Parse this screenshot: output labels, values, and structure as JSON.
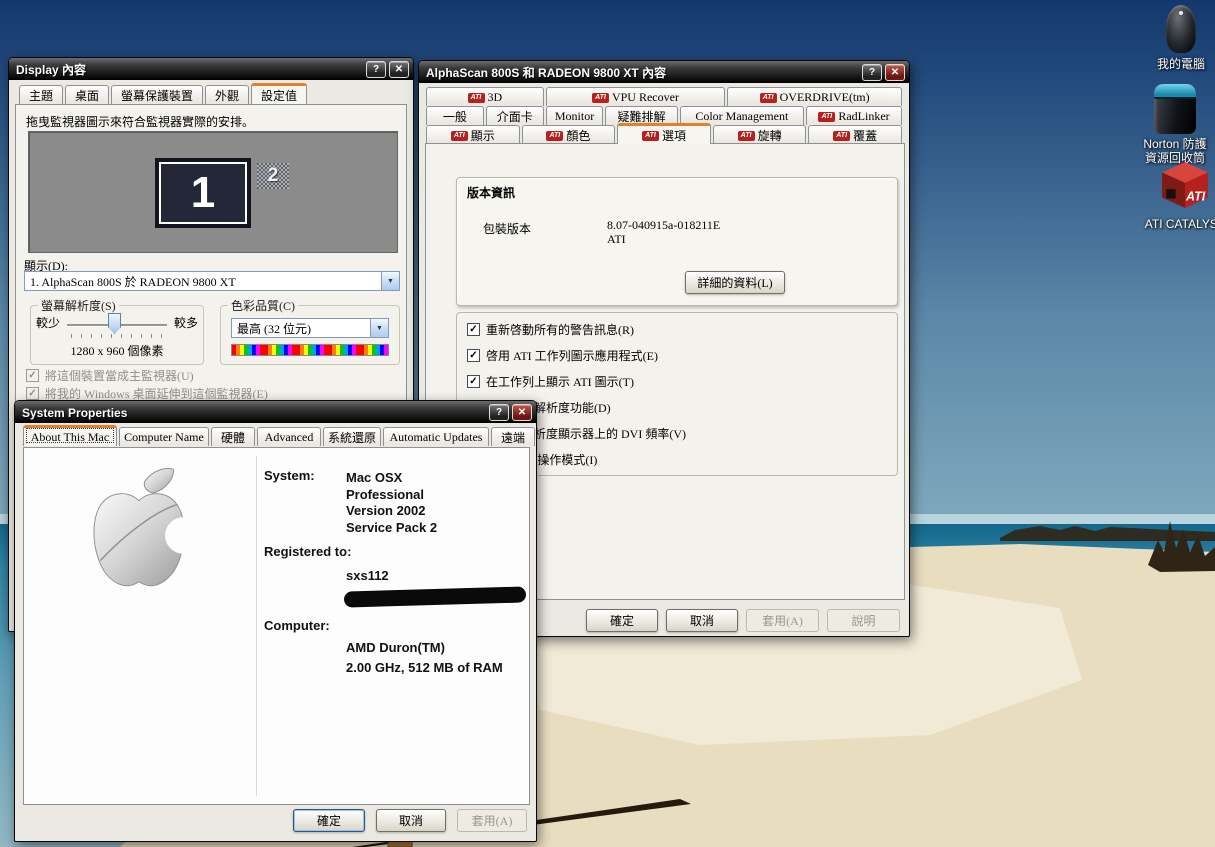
{
  "chrome": {
    "help": "?",
    "close": "✕",
    "check": "✓",
    "chevron": "▼"
  },
  "icons": {
    "ati_chip_text": "ATI"
  },
  "colors": {
    "accent_tab_orange": "#e0812f",
    "titlebar_dark": "#1a1a1a",
    "ati_red": "#b5211d",
    "sky_top": "#16386d",
    "sea": "#2f84a4",
    "sand": "#e8ddbf"
  },
  "desktop": {
    "icons": [
      {
        "name": "my-computer",
        "label": "我的電腦"
      },
      {
        "name": "norton-recycle-bin",
        "label_line1": "Norton 防護",
        "label_line2": "資源回收筒"
      },
      {
        "name": "ati-catalyst",
        "label": "ATI CATALYST"
      }
    ]
  },
  "display_dialog": {
    "title": "Display 內容",
    "tabs": [
      "主題",
      "桌面",
      "螢幕保護裝置",
      "外觀",
      "設定值"
    ],
    "active_tab": "設定值",
    "instruction": "拖曳監視器圖示來符合監視器實際的安排。",
    "monitor1": "1",
    "monitor2": "2",
    "display_label": "顯示(D):",
    "display_value": "1. AlphaScan 800S 於 RADEON 9800 XT",
    "resolution_group": {
      "title": "螢幕解析度(S)",
      "less": "較少",
      "more": "較多",
      "value": "1280 x 960 個像素"
    },
    "color_group": {
      "title": "色彩品質(C)",
      "value": "最高 (32 位元)"
    },
    "checkbox_primary": "將這個裝置當成主監視器(U)",
    "checkbox_extend": "將我的 Windows 桌面延伸到這個監視器(E)"
  },
  "ati_dialog": {
    "title": "AlphaScan 800S 和 RADEON 9800 XT 內容",
    "tab_rows": [
      [
        {
          "label": "3D"
        },
        {
          "label": "VPU Recover"
        },
        {
          "label": "OVERDRIVE(tm)"
        }
      ],
      [
        {
          "label": "一般"
        },
        {
          "label": "介面卡"
        },
        {
          "label": "Monitor"
        },
        {
          "label": "疑難排解"
        },
        {
          "label": "Color Management"
        },
        {
          "label": "RadLinker"
        }
      ],
      [
        {
          "label": "顯示"
        },
        {
          "label": "顏色"
        },
        {
          "label": "選項"
        },
        {
          "label": "旋轉"
        },
        {
          "label": "覆蓋"
        }
      ]
    ],
    "active_tab": "選項",
    "version_group": {
      "title": "版本資訊",
      "label": "包裝版本",
      "value": "8.07-040915a-018211E",
      "vendor": "ATI",
      "details_button": "詳細的資料(L)"
    },
    "checkboxes": [
      {
        "label": "重新啓動所有的警告訊息(R)",
        "checked": true
      },
      {
        "label": "啓用 ATI 工作列圖示應用程式(E)",
        "checked": true
      },
      {
        "label": "在工作列上顯示 ATI 圖示(T)",
        "checked": true
      },
      {
        "label": "停用快速解析度功能(D)",
        "checked": false
      },
      {
        "label": "降低高解析度顯示器上的 DVI 頻率(V)",
        "checked": false
      },
      {
        "label": "替代 DVI 操作模式(I)",
        "checked": false
      }
    ],
    "buttons": {
      "ok": "確定",
      "cancel": "取消",
      "apply": "套用(A)",
      "help": "說明"
    }
  },
  "system_dialog": {
    "title": "System Properties",
    "tabs": [
      "About This Mac",
      "Computer Name",
      "硬體",
      "Advanced",
      "系統還原",
      "Automatic Updates",
      "遠端"
    ],
    "active_tab": "About This Mac",
    "system_label": "System:",
    "system_lines": [
      "Mac OSX",
      "Professional",
      "Version 2002",
      "Service Pack 2"
    ],
    "registered_label": "Registered to:",
    "registered_value": "sxs112",
    "computer_label": "Computer:",
    "computer_lines": [
      "AMD Duron(TM)",
      "2.00 GHz, 512 MB of RAM"
    ],
    "buttons": {
      "ok": "確定",
      "cancel": "取消",
      "apply": "套用(A)"
    }
  }
}
